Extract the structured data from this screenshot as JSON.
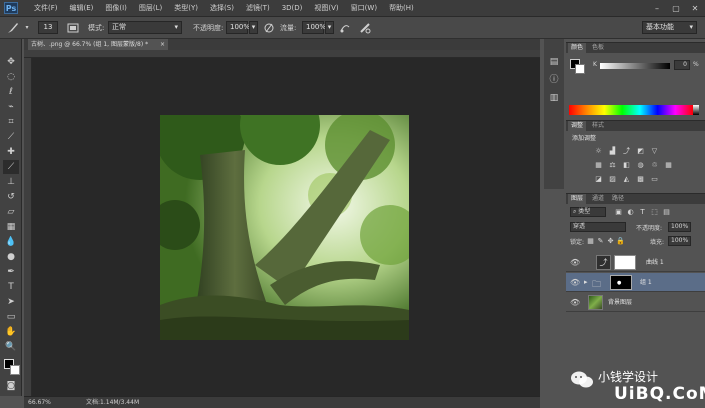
{
  "app": {
    "logo": "Ps"
  },
  "menu": [
    "文件(F)",
    "编辑(E)",
    "图像(I)",
    "图层(L)",
    "类型(Y)",
    "选择(S)",
    "滤镜(T)",
    "3D(D)",
    "视图(V)",
    "窗口(W)",
    "帮助(H)"
  ],
  "window_controls": {
    "minimize": "–",
    "restore": "▢",
    "close": "✕"
  },
  "options": {
    "brush_size": "13",
    "mode_label": "模式:",
    "mode_value": "正常",
    "opacity_label": "不透明度:",
    "opacity_value": "100%",
    "flow_label": "流量:",
    "flow_value": "100%",
    "workspace": "基本功能"
  },
  "document": {
    "tab_title": "古树、.png @ 66.7% (组 1, 图层蒙版/8) *",
    "tab_close": "×",
    "zoom": "66.67%",
    "doc_info": "文档:1.14M/3.44M"
  },
  "color_panel": {
    "tabs": [
      "颜色",
      "色板"
    ],
    "channel_label": "K",
    "value": "0",
    "unit": "%"
  },
  "adjust_panel": {
    "tabs": [
      "调整",
      "样式"
    ],
    "heading": "添加调整"
  },
  "layers_panel": {
    "tabs": [
      "图层",
      "通道",
      "路径"
    ],
    "filter_kind": "类型",
    "blend_mode": "穿透",
    "opacity_label": "不透明度:",
    "opacity_value": "100%",
    "lock_label": "锁定:",
    "fill_label": "填充:",
    "fill_value": "100%",
    "layers": [
      {
        "name": "曲线 1",
        "type": "adjustment",
        "selected": false
      },
      {
        "name": "组 1",
        "type": "group",
        "selected": true
      },
      {
        "name": "背景图层",
        "type": "image",
        "selected": false
      }
    ]
  },
  "watermark": {
    "line1": "小钱学设计",
    "line2": "UiBQ.CoM"
  }
}
